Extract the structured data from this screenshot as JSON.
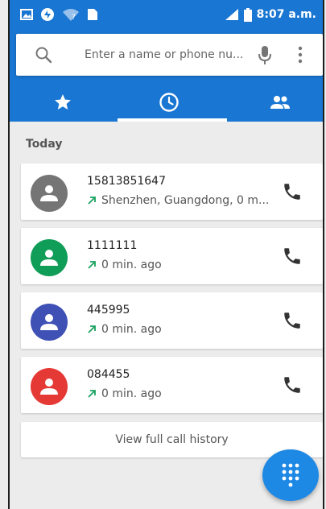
{
  "status_bar": {
    "time": "8:07 a.m.",
    "icons": [
      "image-icon",
      "sync-icon",
      "wifi-icon",
      "sim-icon",
      "signal-icon",
      "battery-icon"
    ]
  },
  "search": {
    "placeholder": "Enter a name or phone nu...",
    "icons": [
      "search-icon",
      "mic-icon",
      "more-vert-icon"
    ]
  },
  "tabs": [
    {
      "icon": "star-icon"
    },
    {
      "icon": "clock-icon",
      "selected": true
    },
    {
      "icon": "people-icon"
    }
  ],
  "section": {
    "title": "Today"
  },
  "calls": [
    {
      "number": "15813851647",
      "detail": "Shenzhen, Guangdong, 0 m...",
      "avatar_color": "#757575"
    },
    {
      "number": "1111111",
      "detail": "0 min. ago",
      "avatar_color": "#0f9d58"
    },
    {
      "number": "445995",
      "detail": "0 min. ago",
      "avatar_color": "#3f51b5"
    },
    {
      "number": "084455",
      "detail": "0 min. ago",
      "avatar_color": "#e53935"
    }
  ],
  "history_link": {
    "label": "View full call history"
  },
  "colors": {
    "primary": "#1976d2",
    "outgoing_arrow": "#1aa260",
    "fab": "#1e88e5"
  }
}
